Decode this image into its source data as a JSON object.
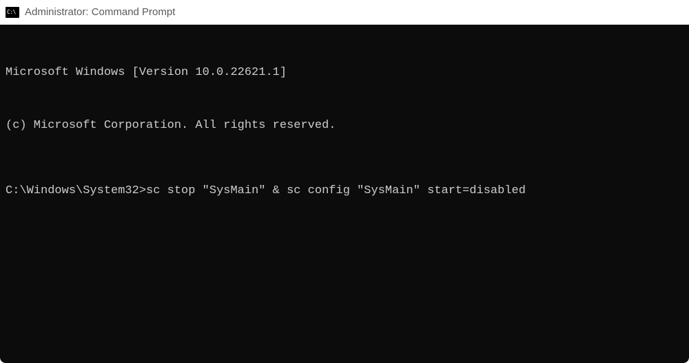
{
  "titlebar": {
    "icon_label": "C:\\",
    "title": "Administrator: Command Prompt"
  },
  "terminal": {
    "banner_line1": "Microsoft Windows [Version 10.0.22621.1]",
    "banner_line2": "(c) Microsoft Corporation. All rights reserved.",
    "prompt_path": "C:\\Windows\\System32>",
    "command": "sc stop \"SysMain\" & sc config \"SysMain\" start=disabled"
  }
}
